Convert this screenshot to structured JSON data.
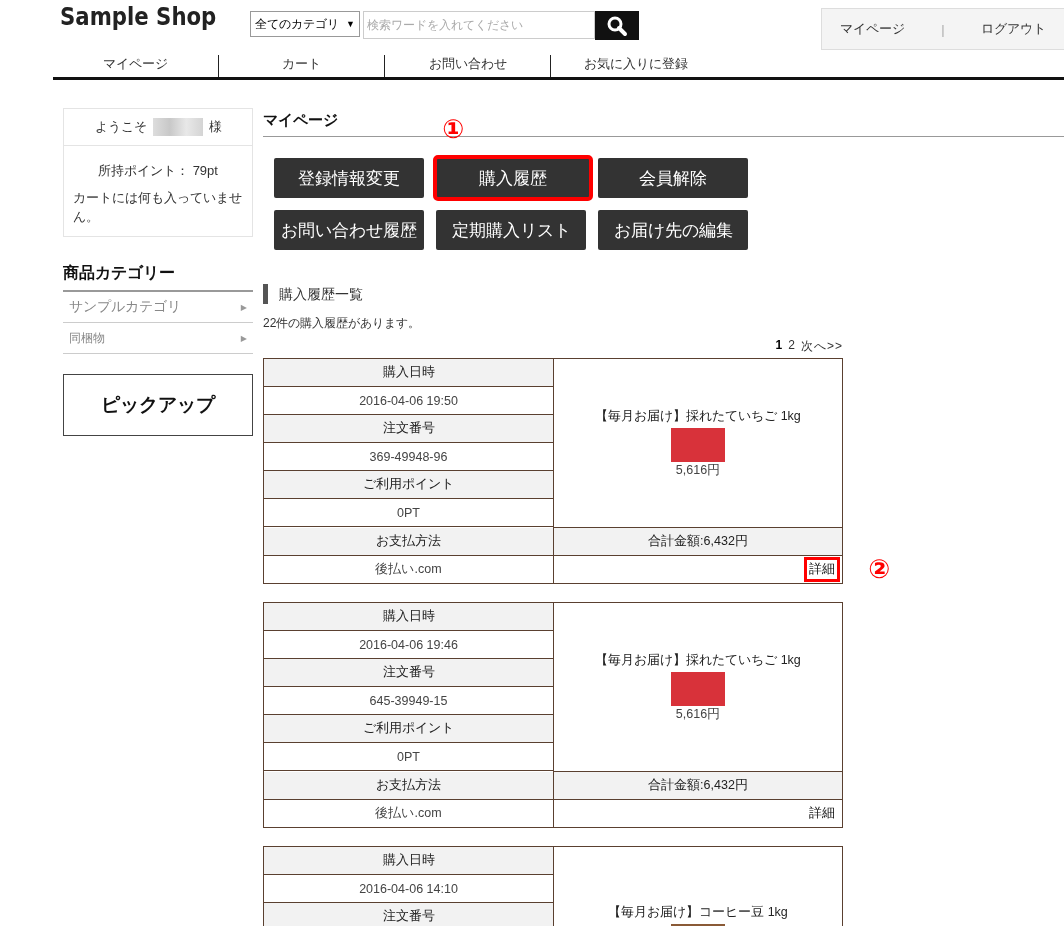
{
  "header": {
    "logo": "Sample Shop",
    "category_select": "全てのカテゴリ",
    "select_arrow": "▼",
    "search_placeholder": "検索ワードを入れてください",
    "account_links": [
      "マイページ",
      "ログアウト"
    ],
    "account_separator": "|"
  },
  "nav": [
    "マイページ",
    "カート",
    "お問い合わせ",
    "お気に入りに登録"
  ],
  "sidebar": {
    "welcome_prefix": "ようこそ",
    "welcome_suffix": "様",
    "points": "所持ポイント： 79pt",
    "cart_message": "カートには何も入っていません。",
    "category_heading": "商品カテゴリー",
    "categories": [
      {
        "label": "サンプルカテゴリ",
        "arrow": "▶"
      },
      {
        "label": "同梱物",
        "arrow": "▶"
      }
    ],
    "pickup": "ピックアップ"
  },
  "main": {
    "title": "マイページ",
    "menu_buttons": [
      {
        "label": "登録情報変更",
        "highlighted": false
      },
      {
        "label": "購入履歴",
        "highlighted": true,
        "annotation": "①"
      },
      {
        "label": "会員解除",
        "highlighted": false
      },
      {
        "label": "お問い合わせ履歴",
        "highlighted": false
      },
      {
        "label": "定期購入リスト",
        "highlighted": false
      },
      {
        "label": "お届け先の編集",
        "highlighted": false
      }
    ],
    "history_heading": "購入履歴一覧",
    "history_count": "22件の購入履歴があります。",
    "pagination": {
      "pages": [
        {
          "label": "1",
          "selected": true
        },
        {
          "label": "2",
          "selected": false
        }
      ],
      "next": "次へ>>"
    },
    "orders": [
      {
        "fields": [
          {
            "label": "購入日時",
            "value": "2016-04-06 19:50"
          },
          {
            "label": "注文番号",
            "value": "369-49948-96"
          },
          {
            "label": "ご利用ポイント",
            "value": "0PT"
          }
        ],
        "product": {
          "name": "【毎月お届け】採れたていちご 1kg",
          "kind": "strawberry",
          "price": "5,616円"
        },
        "payment_label": "お支払方法",
        "payment_value": "後払い.com",
        "total": "合計金額:6,432円",
        "detail": "詳細",
        "detail_highlighted": true,
        "detail_annotation": "②"
      },
      {
        "fields": [
          {
            "label": "購入日時",
            "value": "2016-04-06 19:46"
          },
          {
            "label": "注文番号",
            "value": "645-39949-15"
          },
          {
            "label": "ご利用ポイント",
            "value": "0PT"
          }
        ],
        "product": {
          "name": "【毎月お届け】採れたていちご 1kg",
          "kind": "strawberry",
          "price": "5,616円"
        },
        "payment_label": "お支払方法",
        "payment_value": "後払い.com",
        "total": "合計金額:6,432円",
        "detail": "詳細",
        "detail_highlighted": false
      },
      {
        "fields": [
          {
            "label": "購入日時",
            "value": "2016-04-06 14:10"
          },
          {
            "label": "注文番号"
          }
        ],
        "product": {
          "name": "【毎月お届け】コーヒー豆 1kg",
          "kind": "coffee"
        }
      }
    ]
  }
}
